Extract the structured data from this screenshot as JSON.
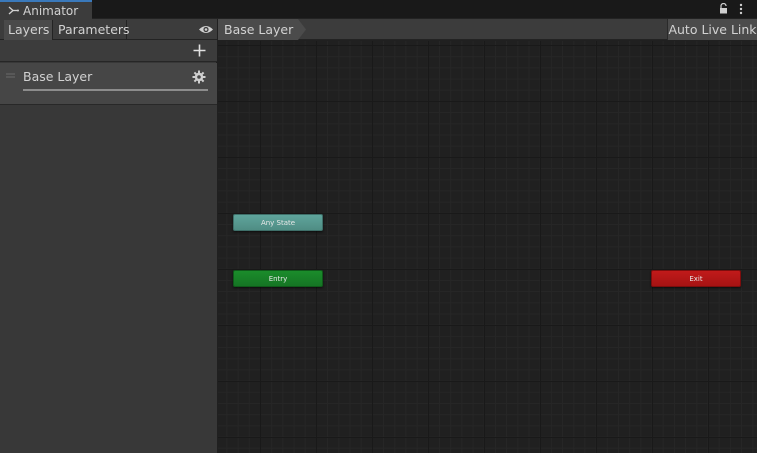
{
  "window": {
    "title": "Animator",
    "icon": "animator-icon"
  },
  "left_panel": {
    "tabs": [
      {
        "label": "Layers",
        "active": true
      },
      {
        "label": "Parameters",
        "active": false
      }
    ],
    "layers": [
      {
        "name": "Base Layer",
        "weight": 1.0
      }
    ]
  },
  "graph": {
    "breadcrumb": "Base Layer",
    "live_link_label": "Auto Live Link",
    "nodes": {
      "any_state": "Any State",
      "entry": "Entry",
      "exit": "Exit"
    }
  },
  "colors": {
    "any_state": "#5fa59c",
    "entry": "#1b8c2b",
    "exit": "#c11a1a",
    "tab_accent": "#3a79bb"
  }
}
